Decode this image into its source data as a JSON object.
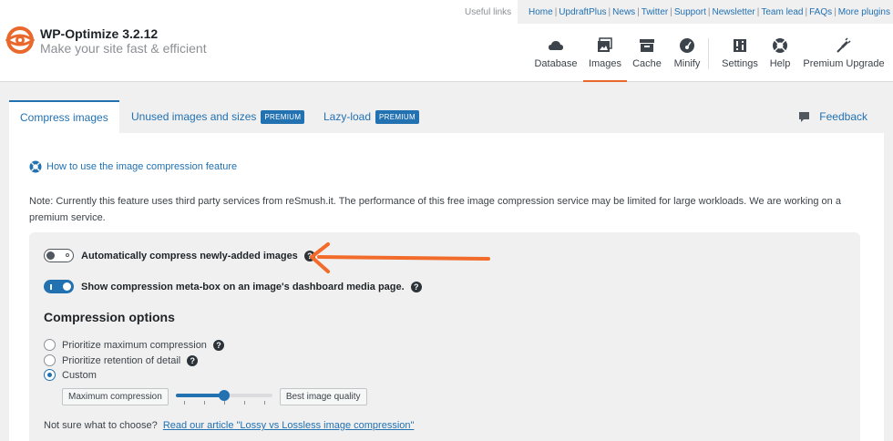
{
  "header": {
    "useful_links_label": "Useful links",
    "links": [
      "Home",
      "UpdraftPlus",
      "News",
      "Twitter",
      "Support",
      "Newsletter",
      "Team lead",
      "FAQs",
      "More plugins"
    ],
    "app_title": "WP-Optimize 3.2.12",
    "tagline": "Make your site fast & efficient",
    "brand_color": "#e9692c"
  },
  "nav": {
    "items": [
      {
        "label": "Database",
        "icon": "database-icon"
      },
      {
        "label": "Images",
        "icon": "images-icon",
        "active": true
      },
      {
        "label": "Cache",
        "icon": "cache-icon"
      },
      {
        "label": "Minify",
        "icon": "minify-icon"
      },
      {
        "label": "Settings",
        "icon": "settings-icon"
      },
      {
        "label": "Help",
        "icon": "help-icon"
      },
      {
        "label": "Premium Upgrade",
        "icon": "premium-upgrade-icon"
      }
    ]
  },
  "tabs": {
    "items": [
      {
        "label": "Compress images",
        "active": true
      },
      {
        "label": "Unused images and sizes",
        "badge": "PREMIUM"
      },
      {
        "label": "Lazy-load",
        "badge": "PREMIUM"
      }
    ],
    "feedback": "Feedback"
  },
  "panel": {
    "help_link": "How to use the image compression feature",
    "note": "Note: Currently this feature uses third party services from reSmush.it. The performance of this free image compression service may be limited for large workloads. We are working on a premium service.",
    "toggles": [
      {
        "label": "Automatically compress newly-added images",
        "on": false
      },
      {
        "label": "Show compression meta-box on an image's dashboard media page.",
        "on": true
      }
    ],
    "compression_heading": "Compression options",
    "radios": [
      {
        "label": "Prioritize maximum compression",
        "checked": false,
        "help": true
      },
      {
        "label": "Prioritize retention of detail",
        "checked": false,
        "help": true
      },
      {
        "label": "Custom",
        "checked": true,
        "help": false
      }
    ],
    "slider": {
      "min_label": "Maximum compression",
      "max_label": "Best image quality",
      "value_fraction": 0.5
    },
    "not_sure_text": "Not sure what to choose?",
    "article_link": "Read our article \"Lossy vs Lossless image compression\""
  },
  "colors": {
    "accent": "#2271b1",
    "arrow": "#f26b2a"
  }
}
